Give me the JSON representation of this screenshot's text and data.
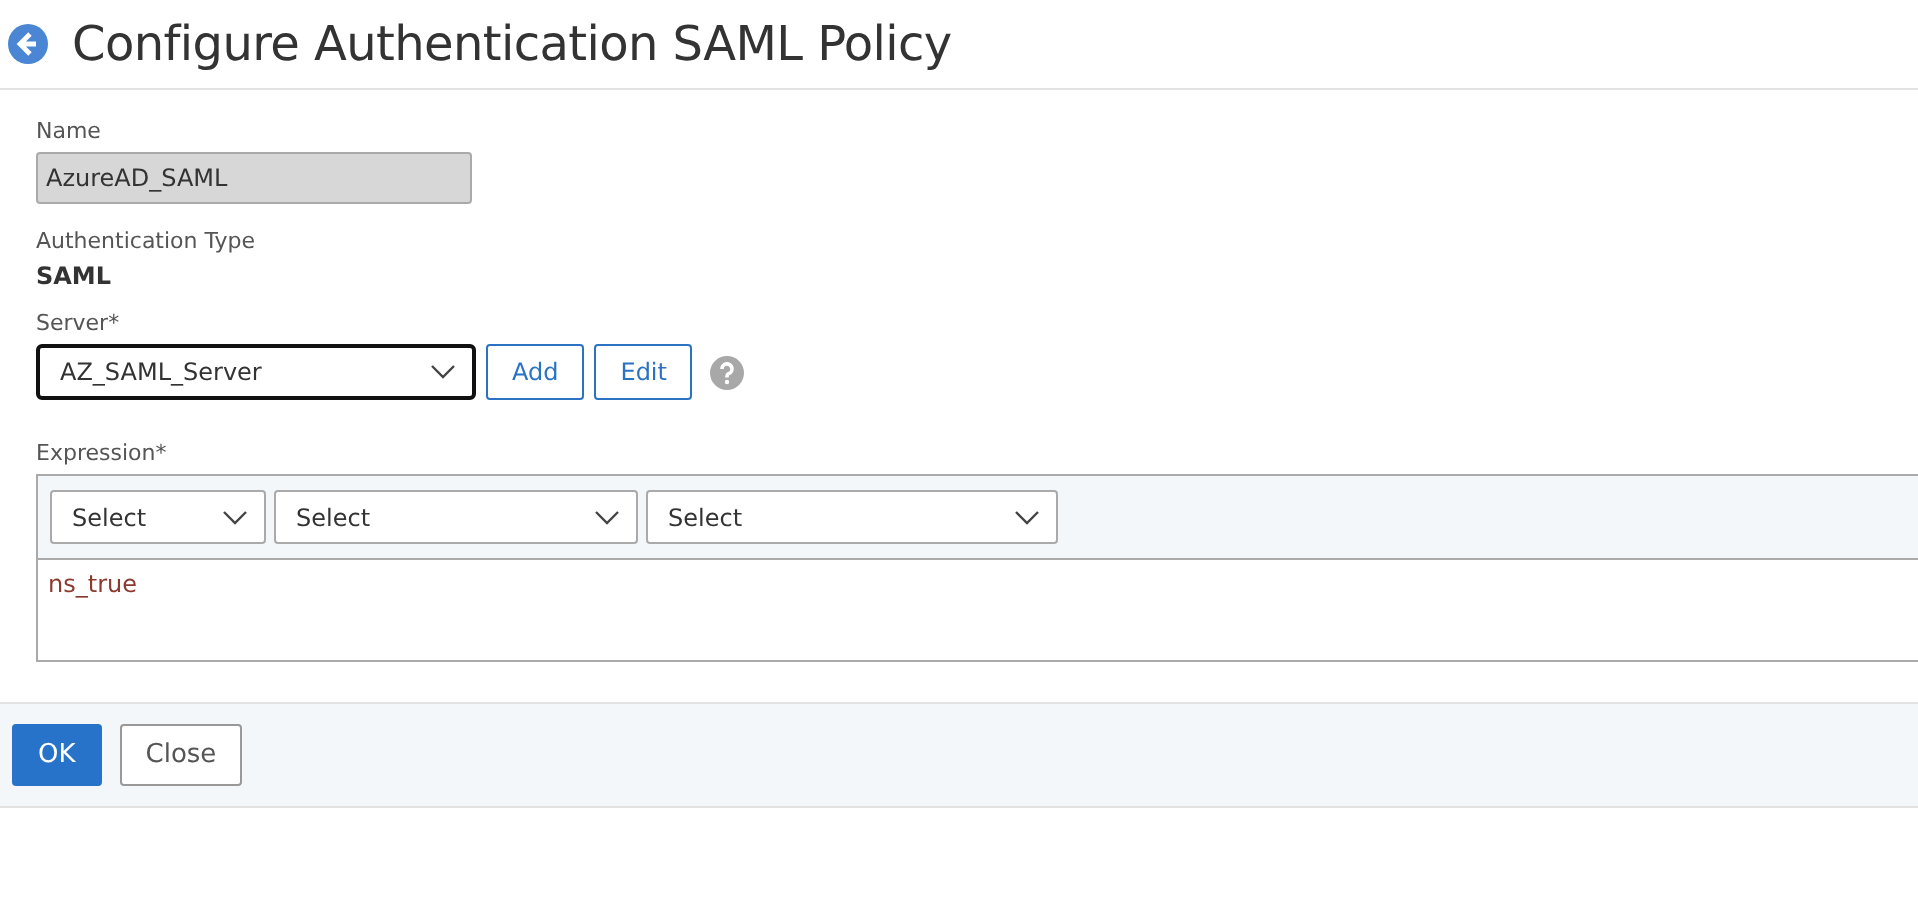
{
  "title": "Configure Authentication SAML Policy",
  "name_field": {
    "label": "Name",
    "value": "AzureAD_SAML",
    "disabled": true
  },
  "auth_type": {
    "label": "Authentication Type",
    "value": "SAML"
  },
  "server": {
    "label": "Server*",
    "value": "AZ_SAML_Server",
    "focused": true,
    "buttons": [
      "Add",
      "Edit"
    ]
  },
  "expression": {
    "label": "Expression*",
    "selects": [
      "Select",
      "Select",
      "Select"
    ],
    "value": "ns_true"
  },
  "footer_buttons": [
    {
      "label": "OK",
      "kind": "primary"
    },
    {
      "label": "Close",
      "kind": "secondary"
    }
  ]
}
